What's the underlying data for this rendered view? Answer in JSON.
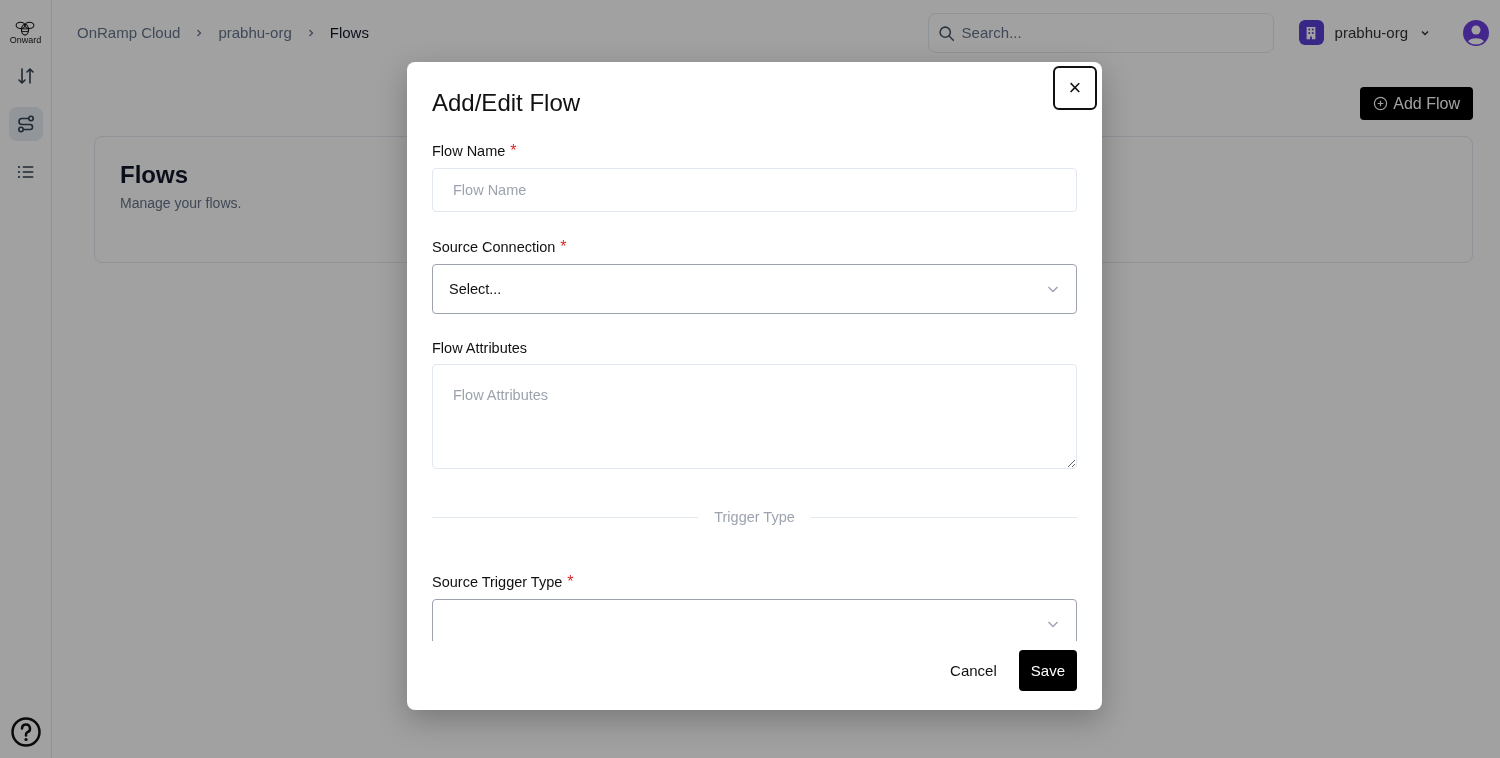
{
  "logo": {
    "text": "Onward"
  },
  "sidebar": {
    "items": [
      {
        "selected": false
      },
      {
        "selected": true
      },
      {
        "selected": false
      }
    ]
  },
  "breadcrumbs": [
    {
      "label": "OnRamp Cloud",
      "current": false
    },
    {
      "label": "prabhu-org",
      "current": false
    },
    {
      "label": "Flows",
      "current": true
    }
  ],
  "search": {
    "placeholder": "Search..."
  },
  "org_switcher": {
    "label": "prabhu-org"
  },
  "add_button": {
    "label": "Add Flow"
  },
  "page": {
    "title": "Flows",
    "subtitle": "Manage your flows."
  },
  "modal": {
    "title": "Add/Edit Flow",
    "close": "×",
    "fields": [
      {
        "kind": "text",
        "label": "Flow Name",
        "required_mark": "*",
        "placeholder": "Flow Name"
      },
      {
        "kind": "select",
        "label": "Source Connection",
        "required_mark": "*",
        "placeholder": "Select..."
      },
      {
        "kind": "textarea",
        "label": "Flow Attributes",
        "placeholder": "Flow Attributes"
      },
      {
        "kind": "divider",
        "label": "Trigger Type"
      },
      {
        "kind": "select",
        "label": "Source Trigger Type",
        "required_mark": "*"
      }
    ],
    "buttons": [
      {
        "kind": "plain",
        "label": "Cancel"
      },
      {
        "kind": "primary",
        "label": "Save"
      }
    ]
  }
}
